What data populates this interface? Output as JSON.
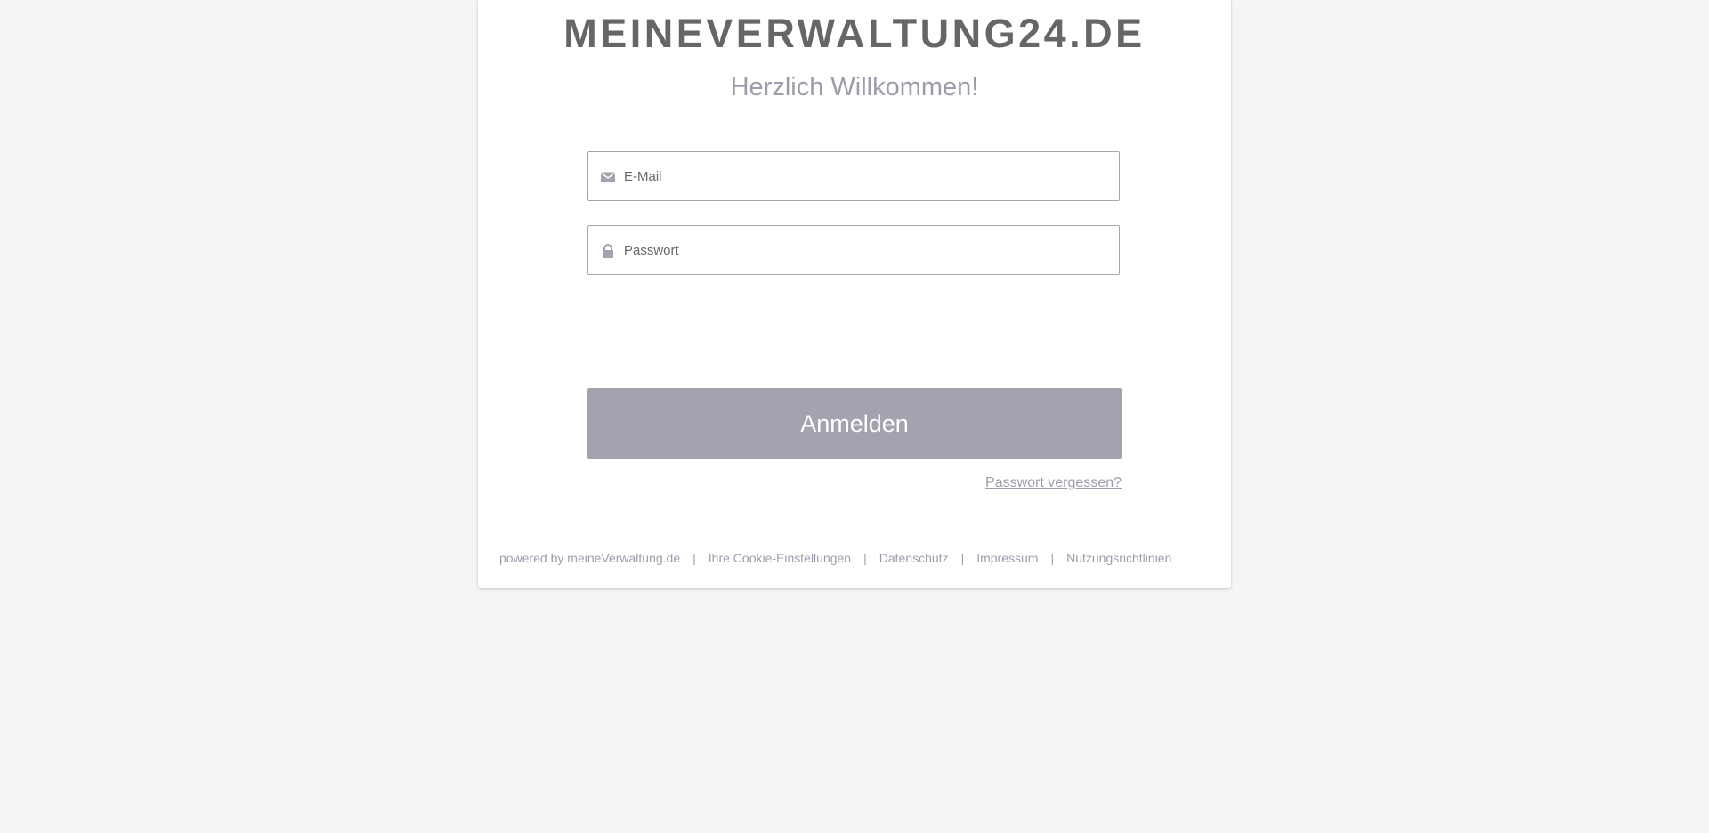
{
  "brand": {
    "title": "MEINEVERWALTUNG24.DE",
    "subtitle": "Herzlich Willkommen!"
  },
  "form": {
    "email_placeholder": "E-Mail",
    "email_icon": "envelope-icon",
    "password_placeholder": "Passwort",
    "password_icon": "lock-icon",
    "submit_label": "Anmelden",
    "forgot_label": "Passwort vergessen?"
  },
  "footer": {
    "powered": "powered by meineVerwaltung.de",
    "separator": "|",
    "links": [
      "Ihre Cookie-Einstellungen",
      "Datenschutz",
      "Impressum",
      "Nutzungsrichtlinien"
    ]
  },
  "colors": {
    "background": "#f4f5f7",
    "card": "#ffffff",
    "brand_text": "#666666",
    "accent_text": "#9d9cac",
    "button": "#a3a2ae"
  }
}
